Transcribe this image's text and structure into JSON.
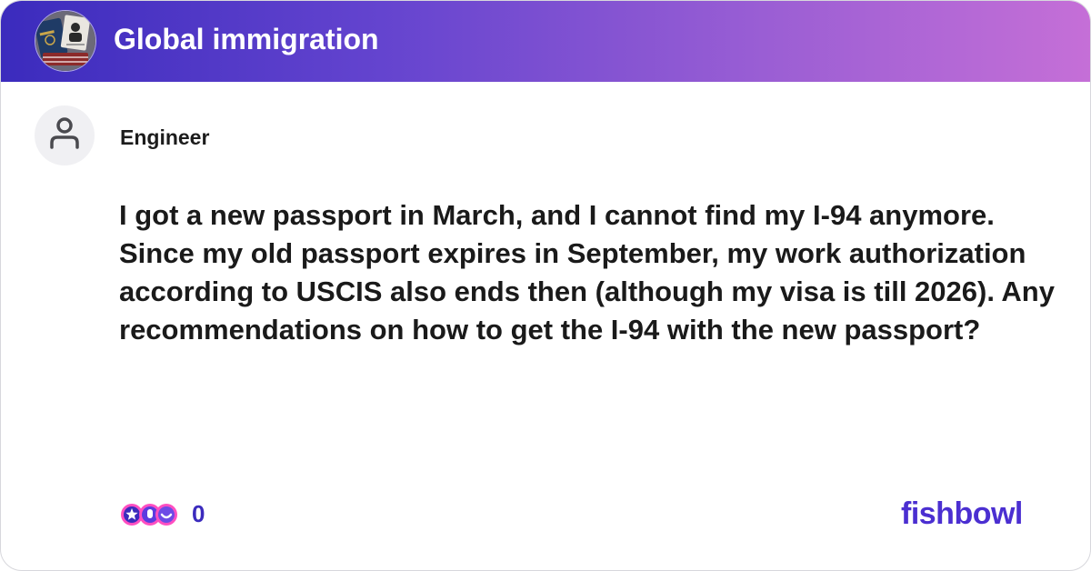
{
  "bowl": {
    "title": "Global immigration",
    "avatar_icon": "passport-stack-image"
  },
  "post": {
    "author": "Engineer",
    "author_icon": "user-silhouette-icon",
    "body": "I got a new passport in March, and I cannot find my I-94 anymore. Since my old passport expires in September, my work authorization according to USCIS also ends then (although my visa is till 2026). Any recommendations on how to get the I-94 with the new passport?"
  },
  "footer": {
    "reaction_icon": "reaction-faces-icon",
    "reaction_count": "0",
    "brand": "fishbowl"
  },
  "colors": {
    "header_gradient_start": "#3b2bbd",
    "header_gradient_end": "#c56fd7",
    "brand": "#4b2fd1",
    "text": "#1a1a1a"
  }
}
